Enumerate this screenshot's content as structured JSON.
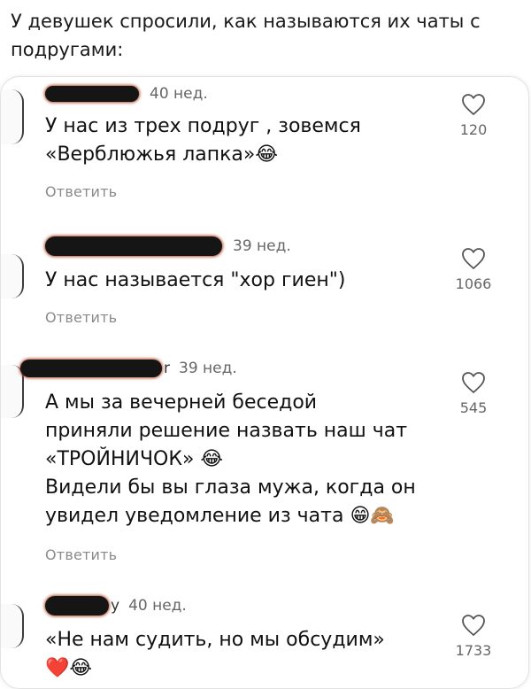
{
  "caption": "У девушек спросили, как называются их чаты с подругами:",
  "comments": [
    {
      "user_suffix": "",
      "time": "40 нед.",
      "lines": [
        "У нас из трех подруг , зовемся",
        "«Верблюжья лапка»😂"
      ],
      "reply": "Ответить",
      "likes": "120"
    },
    {
      "user_suffix": "",
      "time": "39 нед.",
      "lines": [
        "У нас называется \"хор гиен\")"
      ],
      "reply": "Ответить",
      "likes": "1066"
    },
    {
      "user_suffix": "r",
      "time": "39 нед.",
      "lines": [
        "А мы за вечерней беседой",
        "приняли решение назвать наш чат",
        "«ТРОЙНИЧОК» 😂",
        "Видели бы вы глаза мужа, когда он",
        "увидел уведомление из чата 😁🙈"
      ],
      "reply": "Ответить",
      "likes": "545"
    },
    {
      "user_suffix": "у",
      "time": "40 нед.",
      "lines": [
        "«Не нам судить, но мы обсудим»",
        "❤️😂"
      ],
      "reply": "",
      "likes": "1733"
    }
  ],
  "icons": {
    "like": "heart-outline-icon"
  }
}
